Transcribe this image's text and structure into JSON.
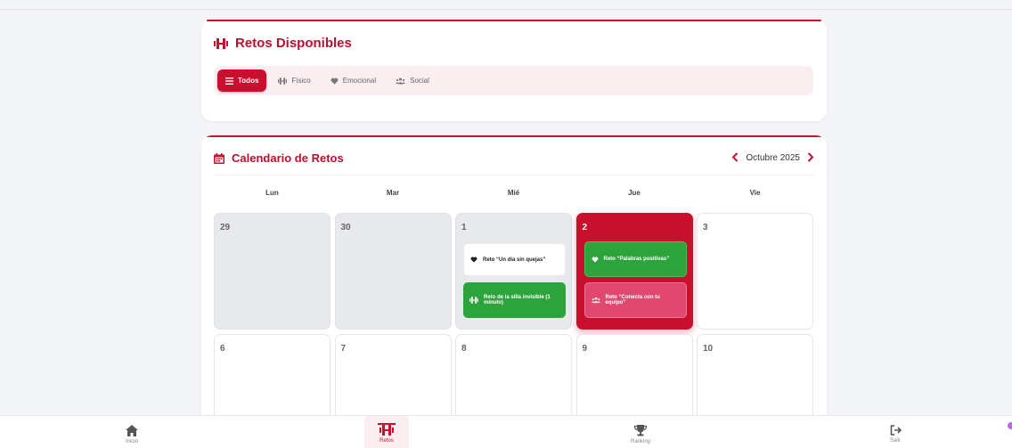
{
  "retos": {
    "title": "Retos Disponibles",
    "filters": [
      {
        "label": "Todos",
        "icon": "list-icon"
      },
      {
        "label": "Físico",
        "icon": "dumbbell-icon"
      },
      {
        "label": "Emocional",
        "icon": "heart-icon"
      },
      {
        "label": "Social",
        "icon": "users-icon"
      }
    ],
    "active_filter": "Todos"
  },
  "calendar": {
    "title": "Calendario de Retos",
    "month_label": "Octubre 2025",
    "weekdays": [
      "Lun",
      "Mar",
      "Mié",
      "Jue",
      "Vie"
    ],
    "days": [
      {
        "num": "29",
        "state": "muted",
        "events": []
      },
      {
        "num": "30",
        "state": "muted",
        "events": []
      },
      {
        "num": "1",
        "state": "past",
        "events": [
          {
            "label": "Reto “Un día sin quejas”",
            "type": "white",
            "icon": "heart-icon"
          },
          {
            "label": "Reto de la silla invisible (1 minuto)",
            "type": "green",
            "icon": "dumbbell-icon"
          }
        ]
      },
      {
        "num": "2",
        "state": "today",
        "events": [
          {
            "label": "Reto “Palabras positivas”",
            "type": "greenlight",
            "icon": "heart-icon"
          },
          {
            "label": "Reto “Conecta con tu equipo”",
            "type": "pink",
            "icon": "users-icon"
          }
        ]
      },
      {
        "num": "3",
        "state": "normal",
        "events": []
      },
      {
        "num": "6",
        "state": "normal",
        "events": []
      },
      {
        "num": "7",
        "state": "normal",
        "events": []
      },
      {
        "num": "8",
        "state": "normal",
        "events": []
      },
      {
        "num": "9",
        "state": "normal",
        "events": []
      },
      {
        "num": "10",
        "state": "normal",
        "events": []
      }
    ]
  },
  "nav": {
    "items": [
      {
        "label": "Inicio",
        "icon": "home-icon"
      },
      {
        "label": "Retos",
        "icon": "dumbbell-icon",
        "active": true
      },
      {
        "label": "Ranking",
        "icon": "trophy-icon"
      },
      {
        "label": "Salir",
        "icon": "logout-icon"
      }
    ]
  },
  "colors": {
    "accent": "#c8102e",
    "green": "#2ca43b",
    "pink": "#e04870"
  }
}
